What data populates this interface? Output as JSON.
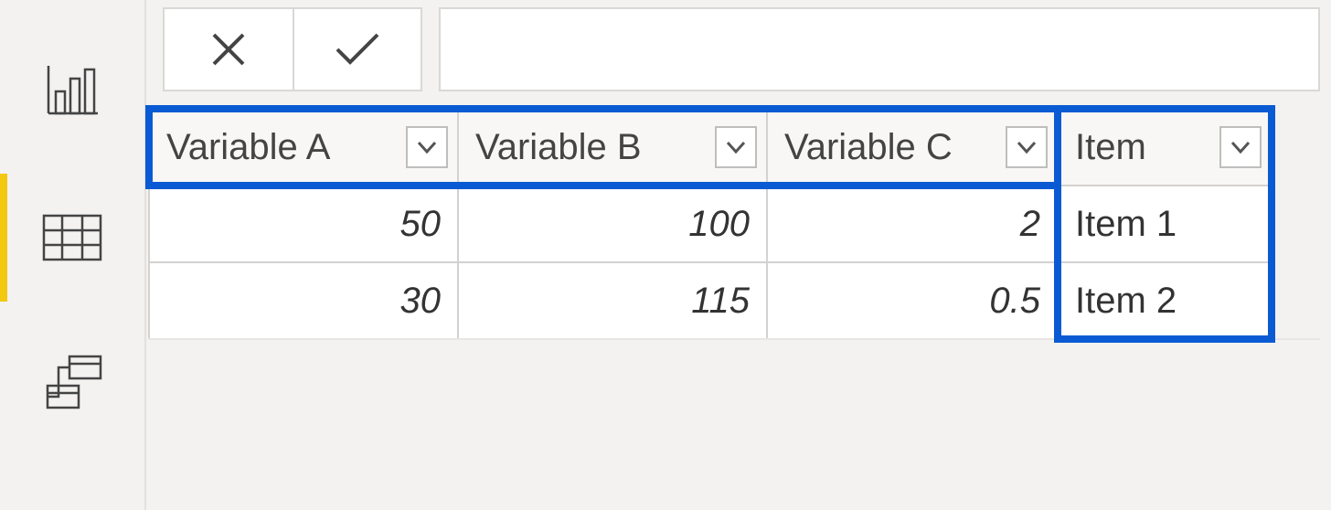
{
  "nav": {
    "items": [
      "report-view",
      "data-view",
      "model-view"
    ],
    "active_index": 1
  },
  "formula_bar": {
    "value": ""
  },
  "table": {
    "columns": [
      {
        "label": "Variable A",
        "type": "number"
      },
      {
        "label": "Variable B",
        "type": "number"
      },
      {
        "label": "Variable C",
        "type": "number"
      },
      {
        "label": "Item",
        "type": "text"
      }
    ],
    "rows": [
      {
        "Variable A": "50",
        "Variable B": "100",
        "Variable C": "2",
        "Item": "Item 1"
      },
      {
        "Variable A": "30",
        "Variable B": "115",
        "Variable C": "0.5",
        "Item": "Item 2"
      }
    ]
  },
  "highlight": {
    "header_cols": [
      0,
      1,
      2
    ],
    "full_col": 3
  }
}
